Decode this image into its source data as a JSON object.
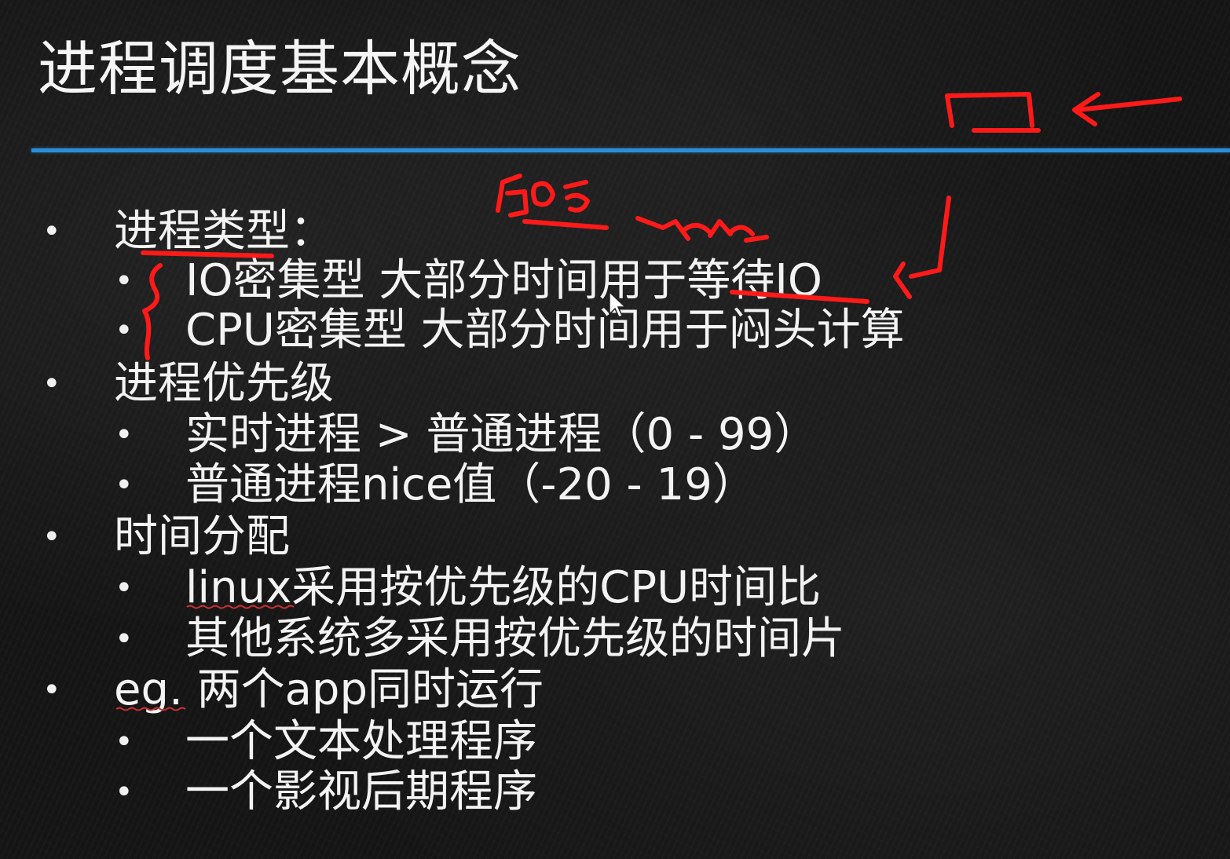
{
  "slide": {
    "title": "进程调度基本概念",
    "accent_color": "#2a8fd6",
    "annotation_color": "#ff1a1a"
  },
  "bullets": [
    {
      "level": 1,
      "text": "进程类型："
    },
    {
      "level": 2,
      "text": "IO密集型 大部分时间用于等待IO"
    },
    {
      "level": 2,
      "text": "CPU密集型 大部分时间用于闷头计算"
    },
    {
      "level": 1,
      "text": "进程优先级"
    },
    {
      "level": 2,
      "text": "实时进程 > 普通进程（0 - 99）"
    },
    {
      "level": 2,
      "text": "普通进程nice值（-20 - 19）"
    },
    {
      "level": 1,
      "text": "时间分配"
    },
    {
      "level": 2,
      "text": "linux采用按优先级的CPU时间比"
    },
    {
      "level": 2,
      "text": "其他系统多采用按优先级的时间片"
    },
    {
      "level": 1,
      "text": "eg. 两个app同时运行"
    },
    {
      "level": 2,
      "text": "一个文本处理程序"
    },
    {
      "level": 2,
      "text": "一个影视后期程序"
    }
  ],
  "icons": {
    "bullet": "bullet-dot",
    "cursor": "mouse-pointer-icon"
  }
}
